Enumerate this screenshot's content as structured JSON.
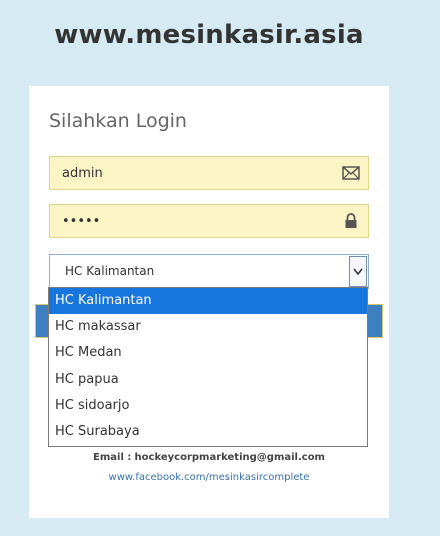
{
  "site": {
    "title": "www.mesinkasir.asia"
  },
  "login": {
    "heading": "Silahkan Login",
    "username_value": "admin",
    "password_value": "•••••",
    "username_icon": "envelope-icon",
    "password_icon": "lock-icon"
  },
  "branch_select": {
    "selected": "HC Kalimantan",
    "options": [
      {
        "label": "HC Kalimantan",
        "highlighted": true
      },
      {
        "label": "HC makassar",
        "highlighted": false
      },
      {
        "label": "HC Medan",
        "highlighted": false
      },
      {
        "label": "HC papua",
        "highlighted": false
      },
      {
        "label": "HC sidoarjo",
        "highlighted": false
      },
      {
        "label": "HC Surabaya",
        "highlighted": false
      }
    ]
  },
  "contact": {
    "email_label": "Email :",
    "email": "hockeycorpmarketing@gmail.com",
    "facebook": "www.facebook.com/mesinkasircomplete"
  },
  "colors": {
    "page_bg": "#d6eaf4",
    "field_bg": "#fbf5c6",
    "highlight": "#1676dd",
    "button": "#3e7fc2",
    "link": "#3a72b5"
  }
}
